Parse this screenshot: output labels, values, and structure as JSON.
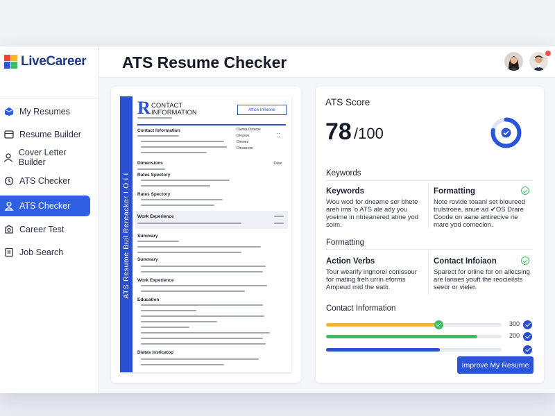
{
  "app": {
    "brand": "LiveCareer",
    "title": "ATS Resume Checker"
  },
  "colors": {
    "brand": "#1f3b87",
    "accent": "#2f5fe3",
    "success": "#3bbf62",
    "warning": "#f2b33d"
  },
  "sidebar": {
    "items": [
      {
        "label": "My Resumes",
        "icon": "resumes-icon"
      },
      {
        "label": "Resume Builder",
        "icon": "builder-icon"
      },
      {
        "label": "Cover Letter Builder",
        "icon": "cover-letter-icon"
      },
      {
        "label": "ATS Checker",
        "icon": "ats-check-icon"
      },
      {
        "label": "ATS Checker",
        "icon": "user-icon",
        "active": true
      },
      {
        "label": "Career Test",
        "icon": "career-test-icon"
      },
      {
        "label": "Job Search",
        "icon": "job-search-icon"
      }
    ]
  },
  "resume": {
    "header_title": "CONTACT\nINFORMATION",
    "header_button": "Attice Inforone",
    "side_text": "ATS Resume Buil Rereacker Ι Ο Ι Ι",
    "sections": {
      "contact": "Contact Information",
      "dimensions": "Dimensions",
      "skills": "Rates Spectory",
      "work1": "Work Experience",
      "summary1": "Summary",
      "summary2": "Summary",
      "work2": "Work Experience",
      "education": "Education",
      "last": "Diatas Insticatop"
    },
    "right_items": [
      "Diansa Ostarpe",
      "Dreaves",
      "Diemes",
      "Dinsaeeen"
    ],
    "dim_tag": "Diioe"
  },
  "score": {
    "section_title": "ATS Score",
    "value": "78",
    "max": "/100",
    "percent": 78,
    "keywords_heading": "Keywords",
    "formatting_heading": "Formatting",
    "contact_heading": "Contact Information",
    "cards": [
      {
        "title": "Keywords",
        "text": "Wou wod for dneame ser bhete\nareh ims 'o ATS ale ady you\nyoeime in ntrieanered atme yod\nsoim."
      },
      {
        "title": "Formatting",
        "text": "Note rovide toaanl set bloureed\ntrulstroee, anue ad ✔OS Drare\nCoode on aane antirecive rie\nmare yod comeclon."
      },
      {
        "title": "Action Verbs",
        "text": "Tour wearify ingnorei conissour\nfor mating freh urrin eforms\nAmpeud mid the eatir."
      },
      {
        "title": "Contact Infoiaon",
        "text": "Sparect for orline for on allecsing\nare lariaes youft the reocieilsts\nseeor or vieler."
      }
    ],
    "bars": [
      {
        "value": 0.64,
        "color": "#f2b33d",
        "label": "300"
      },
      {
        "value": 0.86,
        "color": "#3bbf62",
        "label": "200"
      },
      {
        "value": 0.65,
        "color": "#2b4fd1",
        "label": ""
      }
    ],
    "improve_button": "Improve My Resume"
  }
}
